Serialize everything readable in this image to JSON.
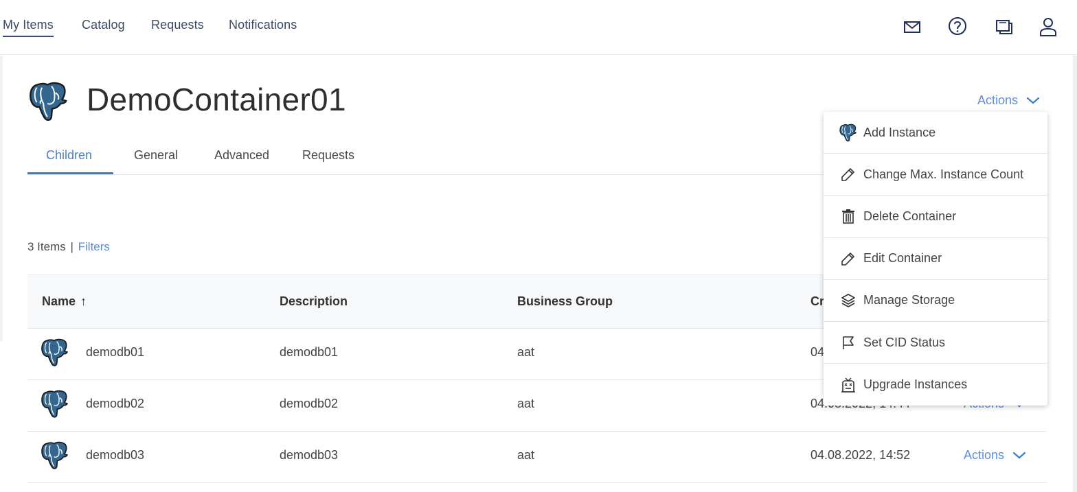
{
  "topnav": {
    "items": [
      {
        "label": "My Items",
        "active": true
      },
      {
        "label": "Catalog",
        "active": false
      },
      {
        "label": "Requests",
        "active": false
      },
      {
        "label": "Notifications",
        "active": false
      }
    ],
    "icons": [
      "mail-icon",
      "help-icon",
      "windows-icon",
      "user-icon"
    ]
  },
  "header": {
    "title": "DemoContainer01",
    "icon": "postgresql-elephant-icon",
    "actions_label": "Actions"
  },
  "tabs": [
    {
      "label": "Children",
      "active": true
    },
    {
      "label": "General",
      "active": false
    },
    {
      "label": "Advanced",
      "active": false
    },
    {
      "label": "Requests",
      "active": false
    }
  ],
  "list": {
    "count_text": "3 Items",
    "separator": "|",
    "filters_label": "Filters"
  },
  "table": {
    "columns": [
      {
        "label": "Name",
        "sort": "ascending",
        "sort_icon": "↑"
      },
      {
        "label": "Description"
      },
      {
        "label": "Business Group"
      },
      {
        "label": "Cr"
      }
    ],
    "rows": [
      {
        "name": "demodb01",
        "description": "demodb01",
        "business_group": "aat",
        "created": "04",
        "actions": ""
      },
      {
        "name": "demodb02",
        "description": "demodb02",
        "business_group": "aat",
        "created": "04.08.2022, 14:44",
        "actions": "Actions"
      },
      {
        "name": "demodb03",
        "description": "demodb03",
        "business_group": "aat",
        "created": "04.08.2022, 14:52",
        "actions": "Actions"
      }
    ]
  },
  "dropdown": {
    "items": [
      {
        "label": "Add Instance",
        "icon": "postgresql-elephant-icon"
      },
      {
        "label": "Change Max. Instance Count",
        "icon": "pencil-icon"
      },
      {
        "label": "Delete Container",
        "icon": "trash-icon"
      },
      {
        "label": "Edit Container",
        "icon": "pencil-icon"
      },
      {
        "label": "Manage Storage",
        "icon": "layers-icon"
      },
      {
        "label": "Set CID Status",
        "icon": "flag-icon"
      },
      {
        "label": "Upgrade Instances",
        "icon": "robot-icon"
      }
    ]
  },
  "colors": {
    "accent": "#2f7fd6",
    "link": "#5f8ee0",
    "nav_text": "#3a4a6b",
    "header_bg": "#f7f8fa"
  }
}
